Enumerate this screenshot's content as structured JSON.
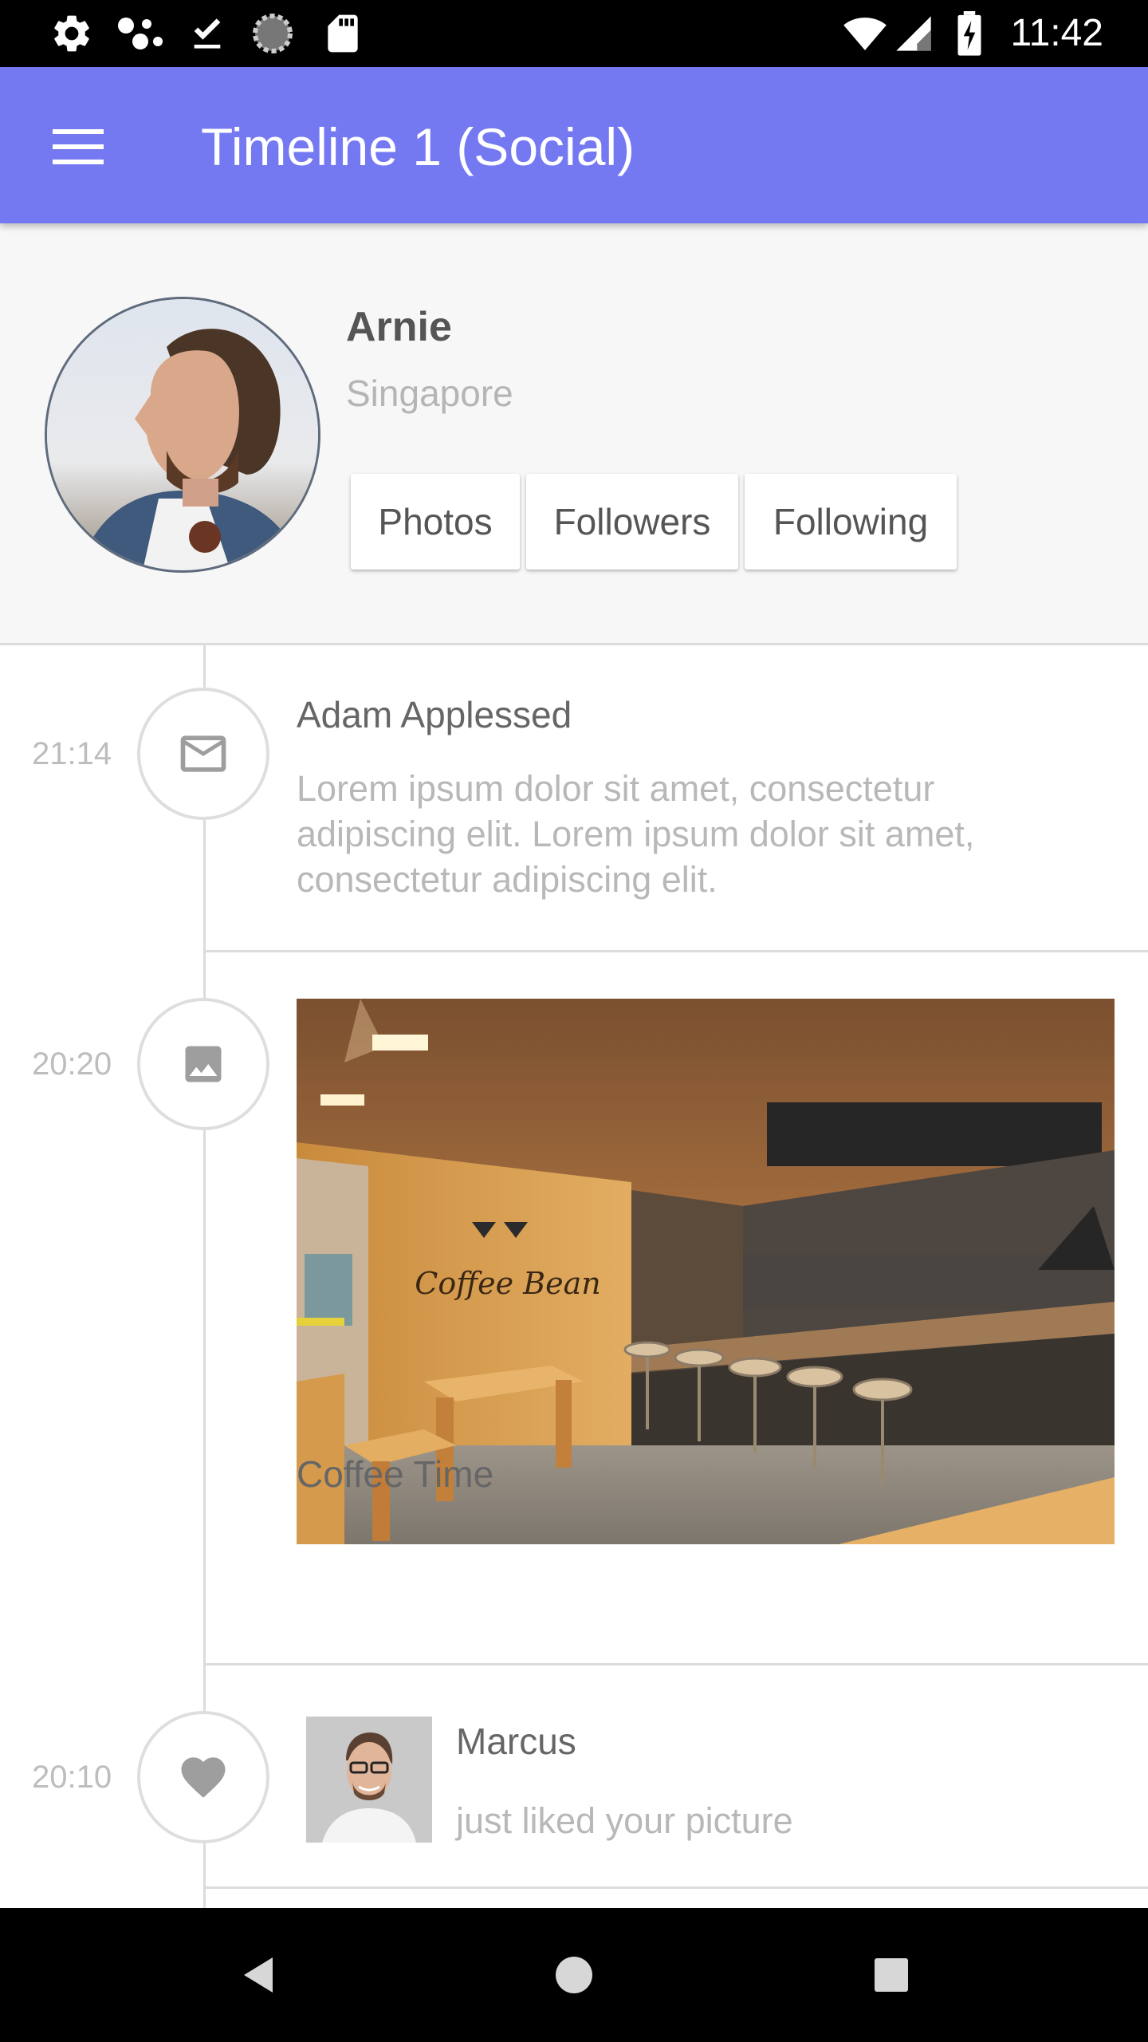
{
  "status_bar": {
    "time": "11:42",
    "left_icons": [
      "settings-icon",
      "dots-icon",
      "download-done-icon",
      "sync-icon",
      "sd-card-icon"
    ],
    "right_icons": [
      "wifi-icon",
      "signal-icon",
      "battery-charging-icon"
    ]
  },
  "app_bar": {
    "title": "Timeline 1 (Social)",
    "menu_icon": "menu-icon",
    "color": "#7479f2"
  },
  "profile": {
    "name": "Arnie",
    "location": "Singapore",
    "buttons": [
      "Photos",
      "Followers",
      "Following"
    ]
  },
  "timeline": [
    {
      "time": "21:14",
      "icon": "mail-icon",
      "title": "Adam Applessed",
      "body": "Lorem ipsum dolor sit amet, consectetur adipiscing elit. Lorem ipsum dolor sit amet, consectetur adipiscing elit."
    },
    {
      "time": "20:20",
      "icon": "image-icon",
      "caption": "Coffee Time",
      "photo_sign": "Coffee Bean"
    },
    {
      "time": "20:10",
      "icon": "heart-icon",
      "title": "Marcus",
      "body": "just liked your picture"
    }
  ],
  "nav_bar": {
    "icons": [
      "back-icon",
      "home-icon",
      "recents-icon"
    ]
  }
}
